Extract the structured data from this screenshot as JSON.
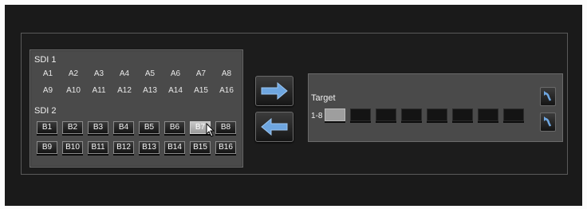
{
  "sdi1": {
    "title": "SDI 1",
    "inputs": [
      "A1",
      "A2",
      "A3",
      "A4",
      "A5",
      "A6",
      "A7",
      "A8",
      "A9",
      "A10",
      "A11",
      "A12",
      "A13",
      "A14",
      "A15",
      "A16"
    ]
  },
  "sdi2": {
    "title": "SDI 2",
    "buttons": [
      "B1",
      "B2",
      "B3",
      "B4",
      "B5",
      "B6",
      "B7",
      "B8",
      "B9",
      "B10",
      "B11",
      "B12",
      "B13",
      "B14",
      "B15",
      "B16"
    ],
    "selected": "B7"
  },
  "transfer": {
    "right_icon": "arrow-right-icon",
    "left_icon": "arrow-left-icon"
  },
  "target": {
    "title": "Target",
    "row_label": "1-8",
    "slot_count": 8,
    "active_slot": 1
  },
  "colors": {
    "panel": "#4a4a4a",
    "background": "#1a1a1a",
    "arrow": "#6ea6e0"
  }
}
